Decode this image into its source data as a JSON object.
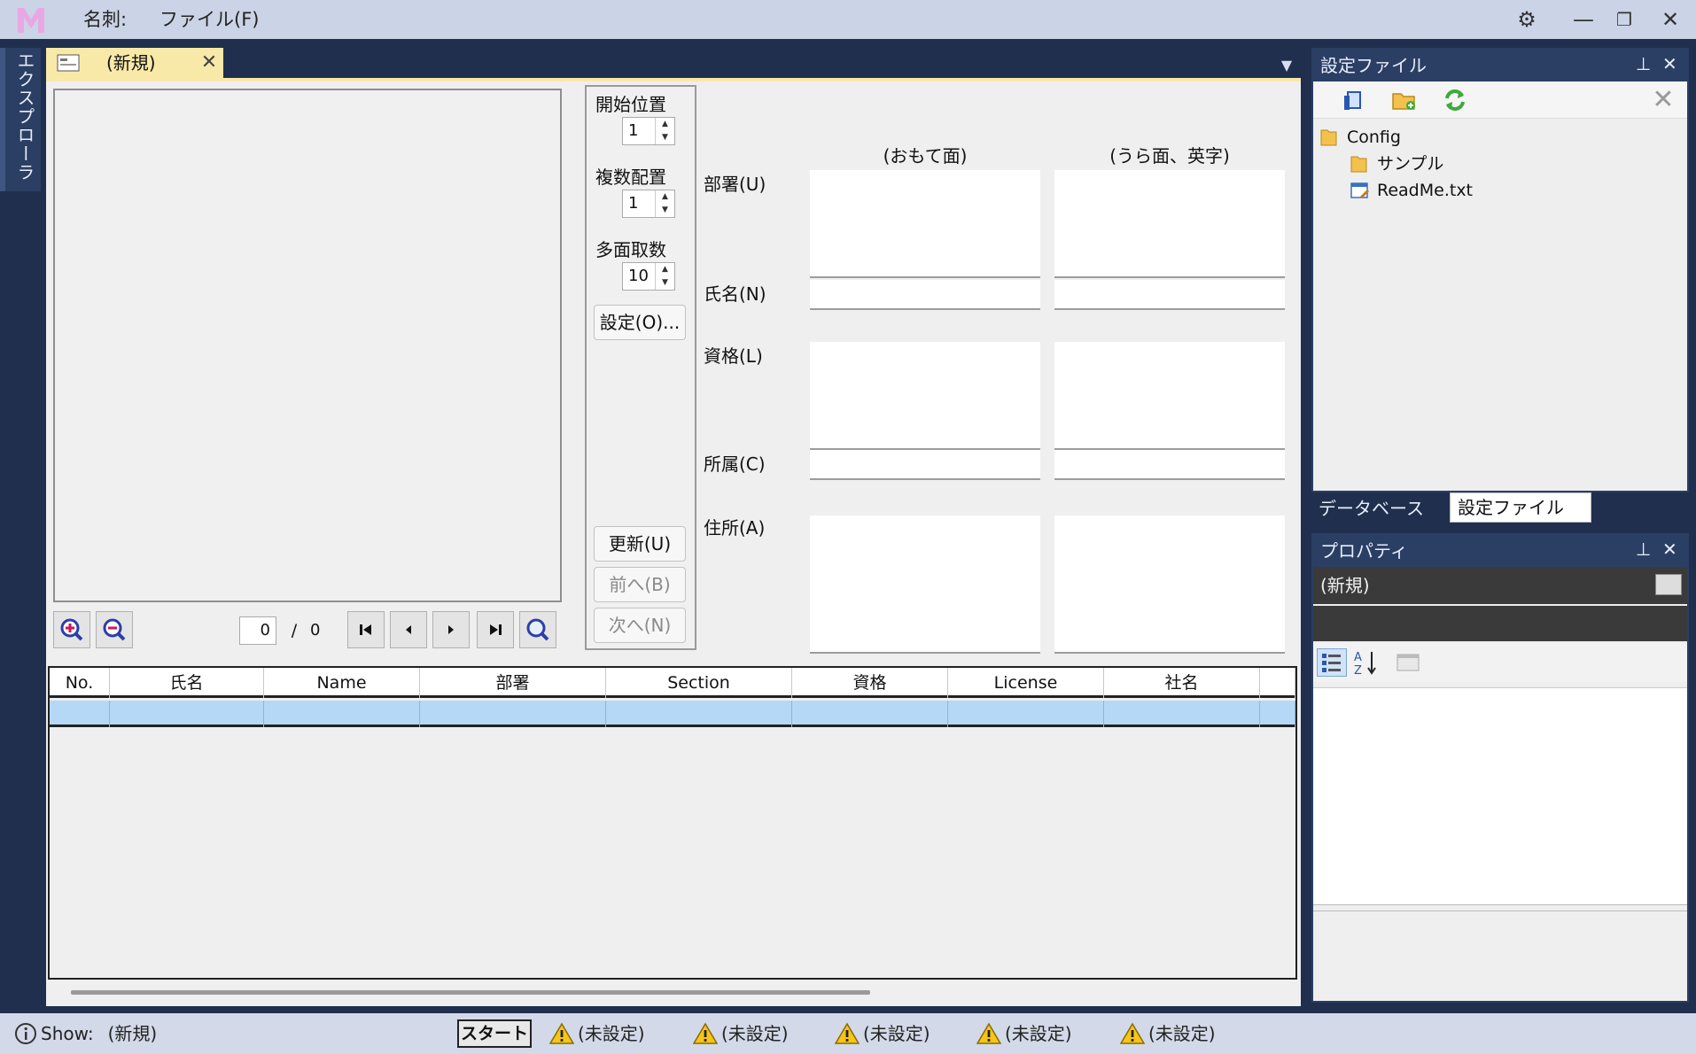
{
  "titlebar": {
    "menus": [
      "名刺:",
      "ファイル(F)"
    ],
    "colors": {
      "logo": "#e8a8e4",
      "bar": "#cbd3e6",
      "frame": "#1f2f4d"
    }
  },
  "explorer": {
    "label": "エクスプローラ"
  },
  "doc_tab": {
    "title": "(新規)",
    "close": "✕"
  },
  "preview": {
    "page_current": "0",
    "page_sep": "/",
    "page_total": "0"
  },
  "settings": {
    "start_label": "開始位置",
    "start_value": "1",
    "multi_label": "複数配置",
    "multi_value": "1",
    "sheets_label": "多面取数",
    "sheets_value": "10",
    "settings_button": "設定(O)...",
    "update_button": "更新(U)",
    "prev_button": "前へ(B)",
    "next_button": "次へ(N)"
  },
  "card": {
    "front_header": "(おもて面)",
    "back_header": "(うら面、英字)",
    "dept_label": "部署(U)",
    "name_label": "氏名(N)",
    "license_label": "資格(L)",
    "org_label": "所属(C)",
    "address_label": "住所(A)"
  },
  "grid": {
    "columns": [
      "No.",
      "氏名",
      "Name",
      "部署",
      "Section",
      "資格",
      "License",
      "社名",
      ""
    ]
  },
  "config_pane": {
    "title": "設定ファイル",
    "tree": [
      {
        "label": "Config",
        "icon": "folder-icon"
      },
      {
        "label": "サンプル",
        "icon": "folder-icon"
      },
      {
        "label": "ReadMe.txt",
        "icon": "text-file-icon"
      }
    ]
  },
  "pane_tabs": {
    "database": "データベース",
    "config": "設定ファイル"
  },
  "props_pane": {
    "title": "プロパティ",
    "object": "(新規)"
  },
  "statusbar": {
    "show_label": "Show:",
    "show_value": "(新規)",
    "start": "スタート",
    "warnings": [
      "(未設定)",
      "(未設定)",
      "(未設定)",
      "(未設定)",
      "(未設定)"
    ]
  }
}
